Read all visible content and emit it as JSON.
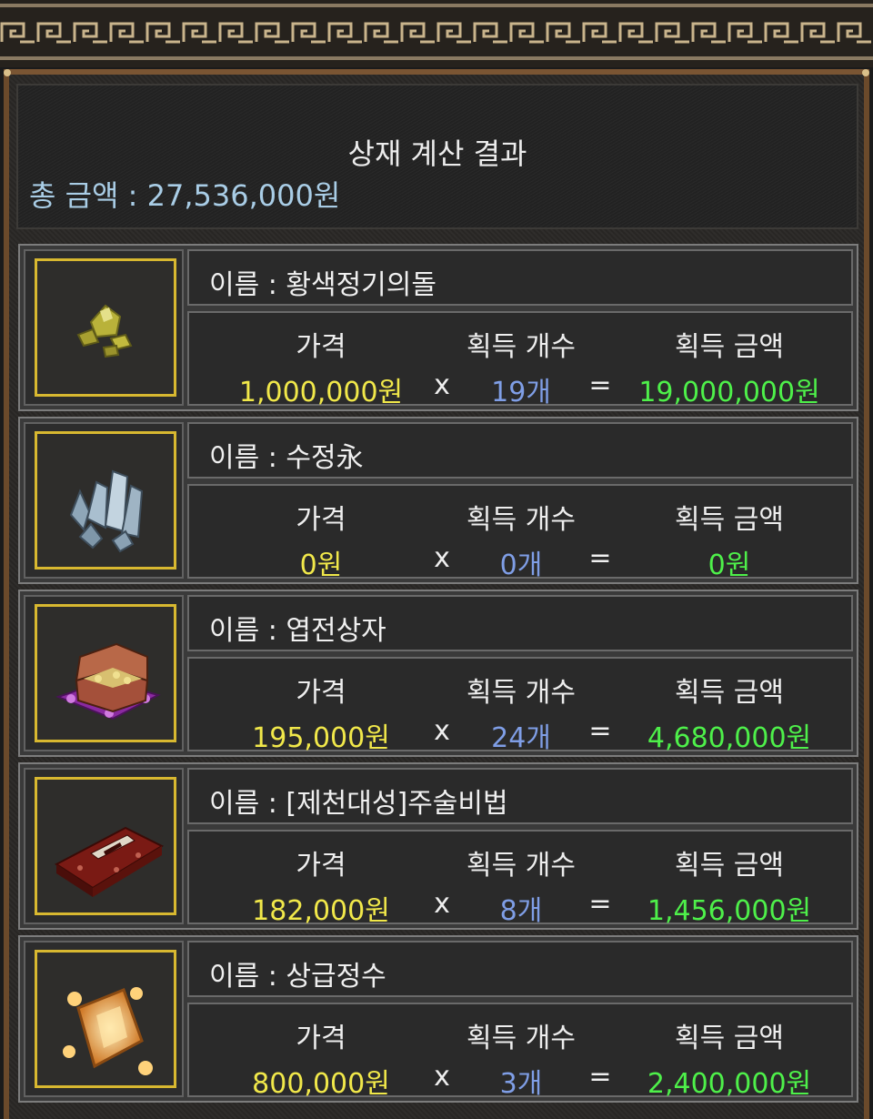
{
  "header": {
    "title": "상재 계산 결과",
    "total": "총 금액 : 27,536,000원"
  },
  "columns": {
    "price": "가격",
    "count": "획득 개수",
    "amount": "획득 금액",
    "times": "x",
    "equals": "="
  },
  "items": [
    {
      "name": "이름 : 황색정기의돌",
      "price": "1,000,000원",
      "count": "19개",
      "amount": "19,000,000원",
      "icon": "yellow-stone-icon"
    },
    {
      "name": "이름 : 수정永",
      "price": "0원",
      "count": "0개",
      "amount": "0원",
      "icon": "crystal-icon"
    },
    {
      "name": "이름 : 엽전상자",
      "price": "195,000원",
      "count": "24개",
      "amount": "4,680,000원",
      "icon": "coin-chest-icon"
    },
    {
      "name": "이름 : [제천대성]주술비법",
      "price": "182,000원",
      "count": "8개",
      "amount": "1,456,000원",
      "icon": "spellbook-icon"
    },
    {
      "name": "이름 : 상급정수",
      "price": "800,000원",
      "count": "3개",
      "amount": "2,400,000원",
      "icon": "essence-crystal-icon"
    }
  ],
  "colors": {
    "price": "#f1e84a",
    "count": "#7f9ee6",
    "amount": "#4ef04a",
    "total": "#a9cde6",
    "slot_border": "#d8b830"
  }
}
